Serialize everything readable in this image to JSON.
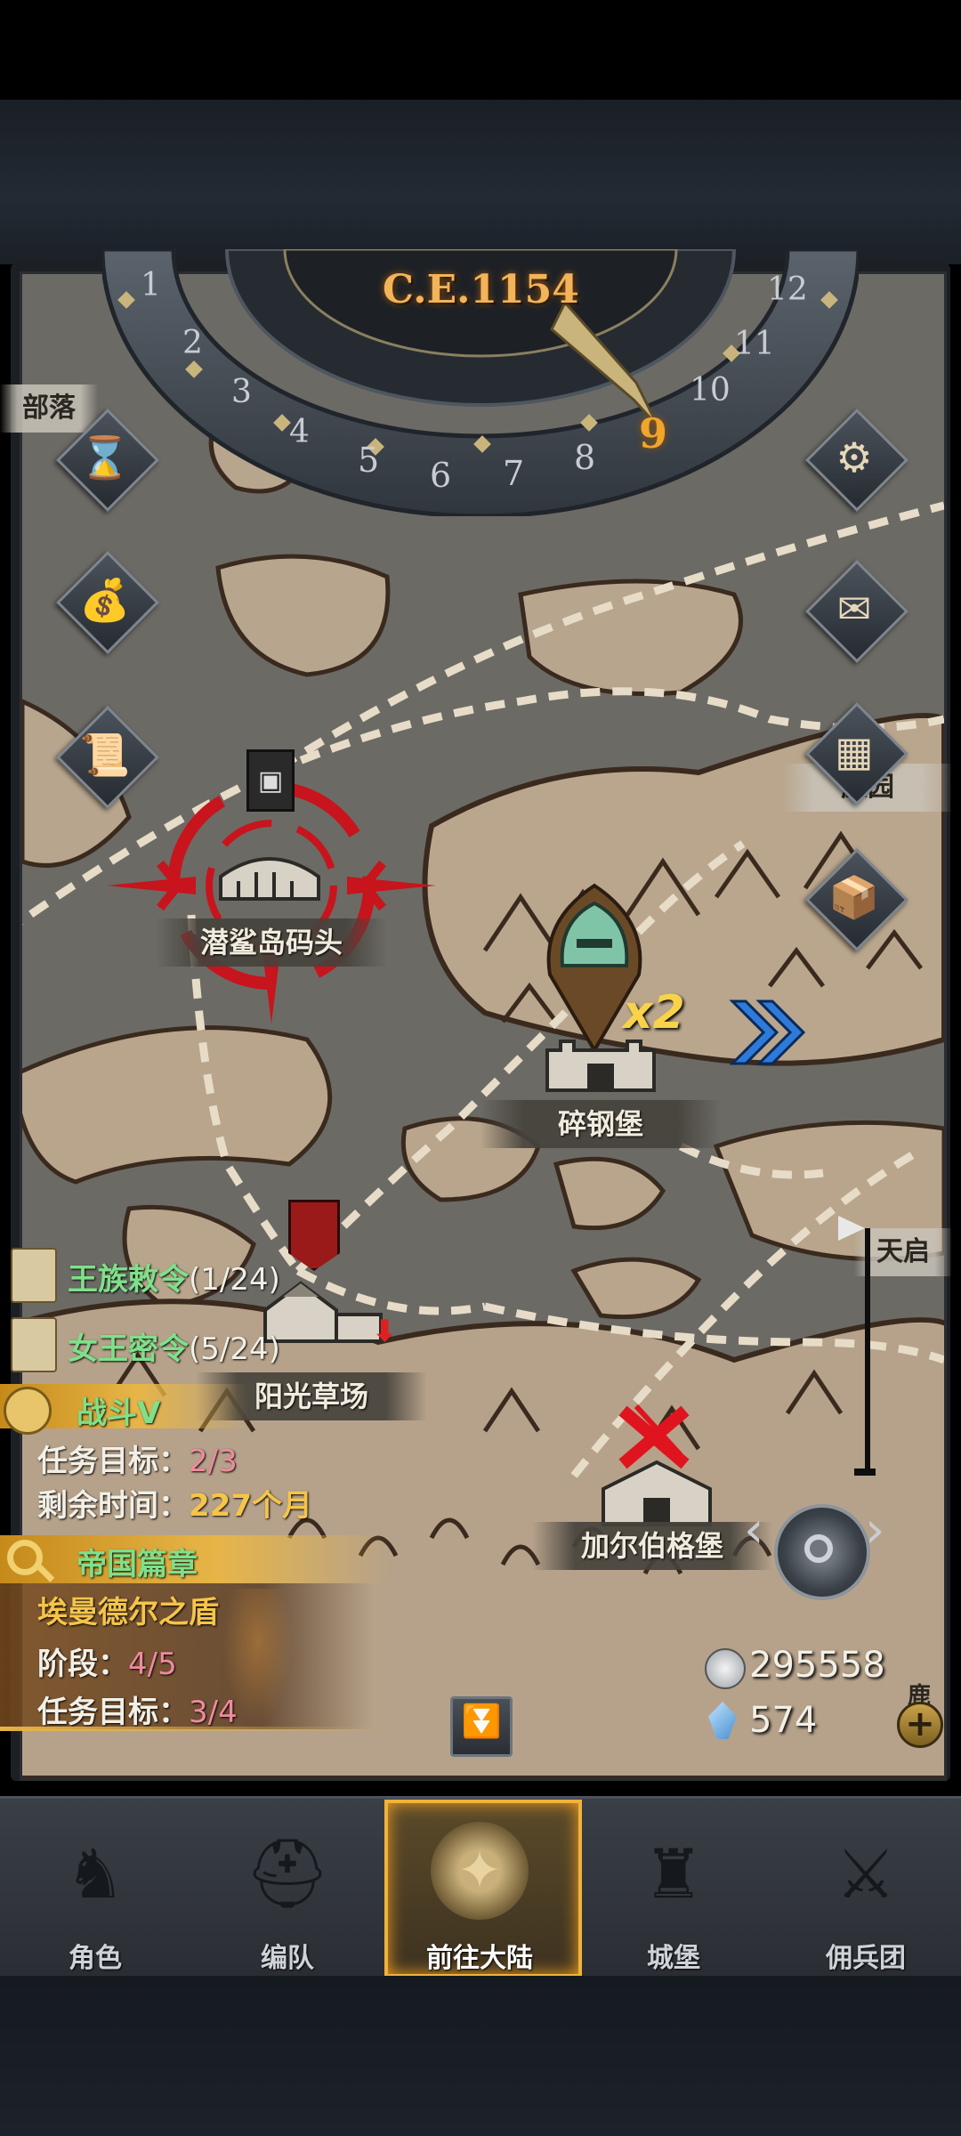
{
  "era": "C.E.1154",
  "dial": {
    "months": [
      "1",
      "2",
      "3",
      "4",
      "5",
      "6",
      "7",
      "8",
      "9",
      "10",
      "11",
      "12"
    ],
    "current_month": "9"
  },
  "locations": {
    "qianshadao": "潜鲨岛码头",
    "suigangbao": "碎钢堡",
    "yangguangcaochang": "阳光草场",
    "jiaerbogebao": "加尔伯格堡",
    "bulao_partial": "部落",
    "zhuangyuan_partial": "庄园",
    "tianqi_partial": "天启",
    "lu_partial": "鹿"
  },
  "multiplier": "x2",
  "quests": {
    "royal_decree": {
      "label": "王族敕令",
      "progress": "(1/24)"
    },
    "queen_order": {
      "label": "女王密令",
      "progress": "(5/24)"
    },
    "battle": {
      "title": "战斗V",
      "target_label": "任务目标：",
      "target_value": "2/3",
      "time_label": "剩余时间：",
      "time_value": "227个月"
    },
    "empire": {
      "title": "帝国篇章",
      "subtitle": "埃曼德尔之盾",
      "stage_label": "阶段：",
      "stage_value": "4/5",
      "target_label": "任务目标：",
      "target_value": "3/4"
    }
  },
  "currency": {
    "silver": "295558",
    "crystal": "574"
  },
  "nav": {
    "items": [
      {
        "label": "角色",
        "icon": "knight-icon"
      },
      {
        "label": "编队",
        "icon": "helmet-icon"
      },
      {
        "label": "前往大陆",
        "icon": "compass-icon"
      },
      {
        "label": "城堡",
        "icon": "castle-icon"
      },
      {
        "label": "佣兵团",
        "icon": "mercenary-icon"
      }
    ],
    "active": "前往大陆"
  },
  "colors": {
    "gold_accent": "#f0b23a",
    "quest_green": "#7fe08a",
    "quest_pink": "#f08aa0",
    "target_red": "#d0181e"
  }
}
